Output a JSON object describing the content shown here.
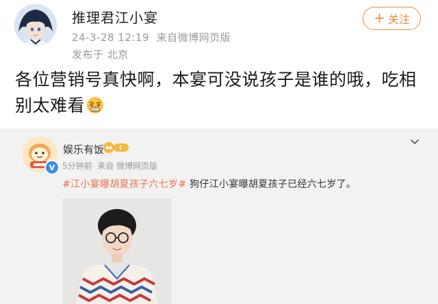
{
  "post": {
    "username": "推理君江小宴",
    "timestamp": "24-3-28 12:19",
    "source": "来自微博网页版",
    "location": "发布于 北京",
    "follow_label": "关注",
    "text": "各位营销号真快啊，本宴可没说孩子是谁的哦，吃相别太难看"
  },
  "repost": {
    "username": "娱乐有饭",
    "time": "5分钟前",
    "source": "来自 微博网页版",
    "topic": "#江小宴曝胡夏孩子六七岁#",
    "text": " 狗仔江小宴曝胡夏孩子已经六七岁了。"
  },
  "icons": {
    "follow": "plus-icon",
    "menu": "chevron-down-icon",
    "verified": "verified-badge-icon",
    "emoji": "grimace-emoji-icon"
  },
  "colors": {
    "accent": "#f08a3c",
    "topic": "#eb7350",
    "verified": "#3a8ee6"
  }
}
